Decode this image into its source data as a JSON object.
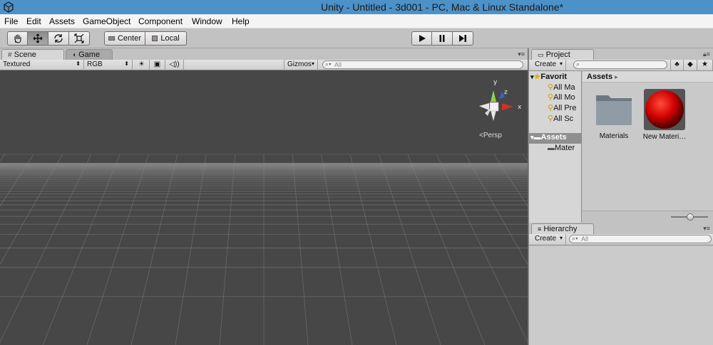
{
  "window": {
    "title": "Unity - Untitled - 3d001 - PC, Mac & Linux Standalone*"
  },
  "menu": [
    "File",
    "Edit",
    "Assets",
    "GameObject",
    "Component",
    "Window",
    "Help"
  ],
  "toolbar": {
    "tools": [
      "hand-icon",
      "move-icon",
      "rotate-icon",
      "scale-icon"
    ],
    "pivot_label": "Center",
    "space_label": "Local",
    "playback": [
      "play-icon",
      "pause-icon",
      "step-icon"
    ]
  },
  "scene": {
    "tabs": [
      "Scene",
      "Game"
    ],
    "render_mode": "Textured",
    "color_mode": "RGB",
    "gizmos_label": "Gizmos",
    "search_placeholder": "All",
    "gizmo_axes": {
      "y": "y",
      "z": "z",
      "x": "x"
    },
    "persp_label": "Persp"
  },
  "project": {
    "tab_label": "Project",
    "create_label": "Create",
    "favorites_label": "Favorit",
    "favorites": [
      "All Ma",
      "All Mo",
      "All Pre",
      "All Sc"
    ],
    "assets_root": "Assets",
    "assets_children": [
      "Mater"
    ],
    "breadcrumb": "Assets",
    "items": [
      {
        "name": "Materials",
        "icon": "folder-icon"
      },
      {
        "name": "New Materi…",
        "icon": "material-sphere-icon"
      }
    ]
  },
  "hierarchy": {
    "tab_label": "Hierarchy",
    "create_label": "Create",
    "search_placeholder": "All"
  },
  "colors": {
    "titlebar": "#4d91c9",
    "viewport": "#474747",
    "selection": "#8f8f8f"
  }
}
